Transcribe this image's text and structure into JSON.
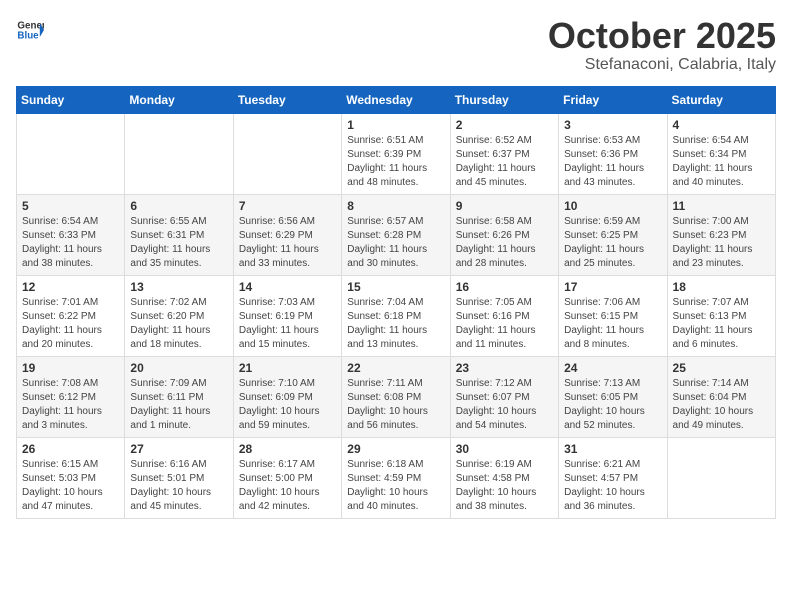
{
  "logo": {
    "general": "General",
    "blue": "Blue"
  },
  "title": {
    "month": "October 2025",
    "location": "Stefanaconi, Calabria, Italy"
  },
  "weekdays": [
    "Sunday",
    "Monday",
    "Tuesday",
    "Wednesday",
    "Thursday",
    "Friday",
    "Saturday"
  ],
  "weeks": [
    [
      null,
      null,
      null,
      {
        "day": "1",
        "info": "Sunrise: 6:51 AM\nSunset: 6:39 PM\nDaylight: 11 hours\nand 48 minutes."
      },
      {
        "day": "2",
        "info": "Sunrise: 6:52 AM\nSunset: 6:37 PM\nDaylight: 11 hours\nand 45 minutes."
      },
      {
        "day": "3",
        "info": "Sunrise: 6:53 AM\nSunset: 6:36 PM\nDaylight: 11 hours\nand 43 minutes."
      },
      {
        "day": "4",
        "info": "Sunrise: 6:54 AM\nSunset: 6:34 PM\nDaylight: 11 hours\nand 40 minutes."
      }
    ],
    [
      {
        "day": "5",
        "info": "Sunrise: 6:54 AM\nSunset: 6:33 PM\nDaylight: 11 hours\nand 38 minutes."
      },
      {
        "day": "6",
        "info": "Sunrise: 6:55 AM\nSunset: 6:31 PM\nDaylight: 11 hours\nand 35 minutes."
      },
      {
        "day": "7",
        "info": "Sunrise: 6:56 AM\nSunset: 6:29 PM\nDaylight: 11 hours\nand 33 minutes."
      },
      {
        "day": "8",
        "info": "Sunrise: 6:57 AM\nSunset: 6:28 PM\nDaylight: 11 hours\nand 30 minutes."
      },
      {
        "day": "9",
        "info": "Sunrise: 6:58 AM\nSunset: 6:26 PM\nDaylight: 11 hours\nand 28 minutes."
      },
      {
        "day": "10",
        "info": "Sunrise: 6:59 AM\nSunset: 6:25 PM\nDaylight: 11 hours\nand 25 minutes."
      },
      {
        "day": "11",
        "info": "Sunrise: 7:00 AM\nSunset: 6:23 PM\nDaylight: 11 hours\nand 23 minutes."
      }
    ],
    [
      {
        "day": "12",
        "info": "Sunrise: 7:01 AM\nSunset: 6:22 PM\nDaylight: 11 hours\nand 20 minutes."
      },
      {
        "day": "13",
        "info": "Sunrise: 7:02 AM\nSunset: 6:20 PM\nDaylight: 11 hours\nand 18 minutes."
      },
      {
        "day": "14",
        "info": "Sunrise: 7:03 AM\nSunset: 6:19 PM\nDaylight: 11 hours\nand 15 minutes."
      },
      {
        "day": "15",
        "info": "Sunrise: 7:04 AM\nSunset: 6:18 PM\nDaylight: 11 hours\nand 13 minutes."
      },
      {
        "day": "16",
        "info": "Sunrise: 7:05 AM\nSunset: 6:16 PM\nDaylight: 11 hours\nand 11 minutes."
      },
      {
        "day": "17",
        "info": "Sunrise: 7:06 AM\nSunset: 6:15 PM\nDaylight: 11 hours\nand 8 minutes."
      },
      {
        "day": "18",
        "info": "Sunrise: 7:07 AM\nSunset: 6:13 PM\nDaylight: 11 hours\nand 6 minutes."
      }
    ],
    [
      {
        "day": "19",
        "info": "Sunrise: 7:08 AM\nSunset: 6:12 PM\nDaylight: 11 hours\nand 3 minutes."
      },
      {
        "day": "20",
        "info": "Sunrise: 7:09 AM\nSunset: 6:11 PM\nDaylight: 11 hours\nand 1 minute."
      },
      {
        "day": "21",
        "info": "Sunrise: 7:10 AM\nSunset: 6:09 PM\nDaylight: 10 hours\nand 59 minutes."
      },
      {
        "day": "22",
        "info": "Sunrise: 7:11 AM\nSunset: 6:08 PM\nDaylight: 10 hours\nand 56 minutes."
      },
      {
        "day": "23",
        "info": "Sunrise: 7:12 AM\nSunset: 6:07 PM\nDaylight: 10 hours\nand 54 minutes."
      },
      {
        "day": "24",
        "info": "Sunrise: 7:13 AM\nSunset: 6:05 PM\nDaylight: 10 hours\nand 52 minutes."
      },
      {
        "day": "25",
        "info": "Sunrise: 7:14 AM\nSunset: 6:04 PM\nDaylight: 10 hours\nand 49 minutes."
      }
    ],
    [
      {
        "day": "26",
        "info": "Sunrise: 6:15 AM\nSunset: 5:03 PM\nDaylight: 10 hours\nand 47 minutes."
      },
      {
        "day": "27",
        "info": "Sunrise: 6:16 AM\nSunset: 5:01 PM\nDaylight: 10 hours\nand 45 minutes."
      },
      {
        "day": "28",
        "info": "Sunrise: 6:17 AM\nSunset: 5:00 PM\nDaylight: 10 hours\nand 42 minutes."
      },
      {
        "day": "29",
        "info": "Sunrise: 6:18 AM\nSunset: 4:59 PM\nDaylight: 10 hours\nand 40 minutes."
      },
      {
        "day": "30",
        "info": "Sunrise: 6:19 AM\nSunset: 4:58 PM\nDaylight: 10 hours\nand 38 minutes."
      },
      {
        "day": "31",
        "info": "Sunrise: 6:21 AM\nSunset: 4:57 PM\nDaylight: 10 hours\nand 36 minutes."
      },
      null
    ]
  ]
}
